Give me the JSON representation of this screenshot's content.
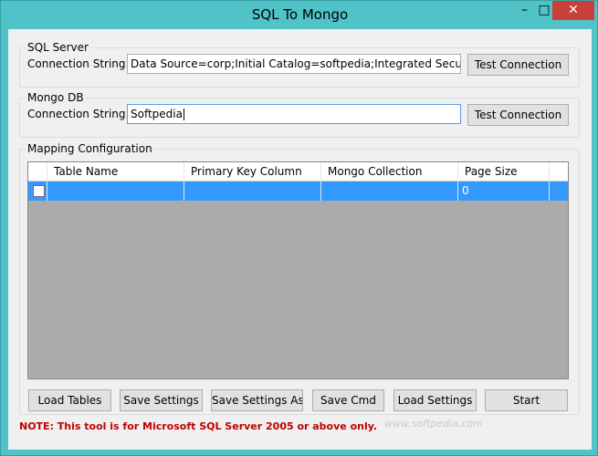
{
  "window": {
    "title": "SQL To Mongo",
    "minimize_glyph": "–",
    "maximize_glyph": "□",
    "close_glyph": "✕"
  },
  "sql_server": {
    "group_label": "SQL Server",
    "connection_label": "Connection String:",
    "connection_value": "Data Source=corp;Initial Catalog=softpedia;Integrated Security=False",
    "test_button": "Test Connection"
  },
  "mongo_db": {
    "group_label": "Mongo DB",
    "connection_label": "Connection String:",
    "connection_value": "Softpedia",
    "test_button": "Test Connection"
  },
  "mapping": {
    "group_label": "Mapping Configuration",
    "columns": [
      "Table Name",
      "Primary Key Column",
      "Mongo Collection",
      "Page Size"
    ],
    "rows": [
      {
        "checked": false,
        "table_name": "",
        "primary_key": "",
        "mongo_collection": "",
        "page_size": "0"
      }
    ]
  },
  "actions": {
    "load_tables": "Load Tables",
    "save_settings": "Save Settings",
    "save_settings_as": "Save Settings As",
    "save_cmd": "Save Cmd",
    "load_settings": "Load Settings",
    "start": "Start"
  },
  "note": "NOTE: This tool is for Microsoft SQL Server 2005 or above only.",
  "watermark": "www.softpedia.com",
  "colors": {
    "frame": "#4fc3c7",
    "selection": "#3399ff",
    "note": "#c00000",
    "close_button": "#c7403a"
  }
}
